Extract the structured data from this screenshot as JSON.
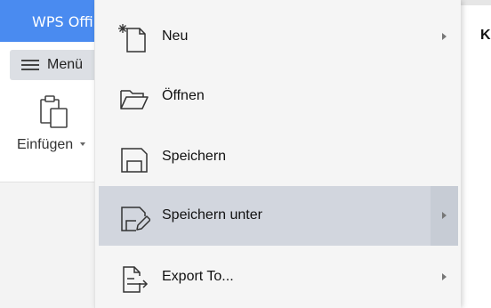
{
  "app": {
    "title": "WPS Offi"
  },
  "menu_button": {
    "label": "Menü",
    "icon": "hamburger-icon"
  },
  "toolbar": {
    "paste_label": "Einfügen",
    "paste_icon": "clipboard-icon"
  },
  "right_edge": {
    "letter": "K"
  },
  "dropdown": {
    "items": [
      {
        "label": "Neu",
        "icon": "new-document-icon",
        "has_submenu": true
      },
      {
        "label": "Öffnen",
        "icon": "folder-open-icon",
        "has_submenu": false
      },
      {
        "label": "Speichern",
        "icon": "save-icon",
        "has_submenu": false
      },
      {
        "label": "Speichern unter",
        "icon": "save-as-icon",
        "has_submenu": true,
        "highlighted": true
      },
      {
        "label": "Export To...",
        "icon": "export-icon",
        "has_submenu": true
      }
    ]
  },
  "colors": {
    "title_bar": "#4a8bf0",
    "menu_highlight": "#d2d6de",
    "menu_bg": "#f5f5f5"
  }
}
